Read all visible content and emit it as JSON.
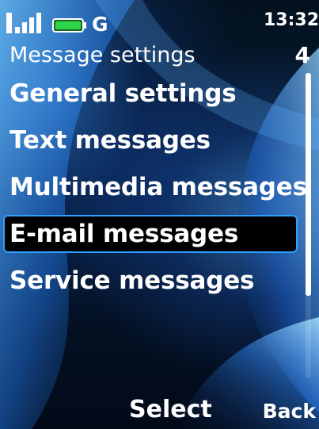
{
  "status_bar": {
    "network": "G",
    "clock": "13:32",
    "signal_icon": "signal-bars-icon",
    "battery_icon": "battery-icon",
    "battery_color": "#2fd44a"
  },
  "title_bar": {
    "title": "Message settings",
    "page": "4"
  },
  "menu": {
    "items": [
      {
        "label": "General settings"
      },
      {
        "label": "Text messages"
      },
      {
        "label": "Multimedia messages"
      },
      {
        "label": "E-mail messages"
      },
      {
        "label": "Service messages"
      }
    ],
    "selected_index": 3,
    "highlight_color": "#2ea0ff"
  },
  "scrollbar": {
    "position": 0.73
  },
  "softkeys": {
    "center": "Select",
    "right": "Back"
  }
}
